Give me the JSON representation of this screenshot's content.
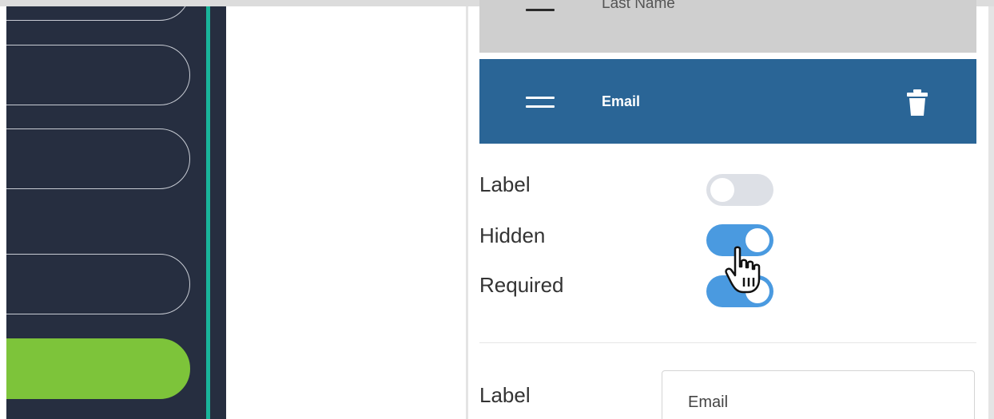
{
  "form_fields": [
    {
      "label": "Last Name",
      "selected": false
    },
    {
      "label": "Email",
      "selected": true
    }
  ],
  "field_options": [
    {
      "label": "Label",
      "enabled": false
    },
    {
      "label": "Hidden",
      "enabled": true
    },
    {
      "label": "Required",
      "enabled": true
    }
  ],
  "properties": {
    "label_caption": "Label",
    "label_value": "Email"
  },
  "icons": {
    "drag": "drag-handle-icon",
    "delete": "trash-icon",
    "pointer": "hand-pointer-icon"
  },
  "colors": {
    "sidebar": "#262e40",
    "sidebar_accent": "#19b49a",
    "active_nav": "#7dc43a",
    "selected_field": "#2a6596",
    "toggle_on": "#4a9ae0",
    "toggle_off": "#dde0e6"
  }
}
